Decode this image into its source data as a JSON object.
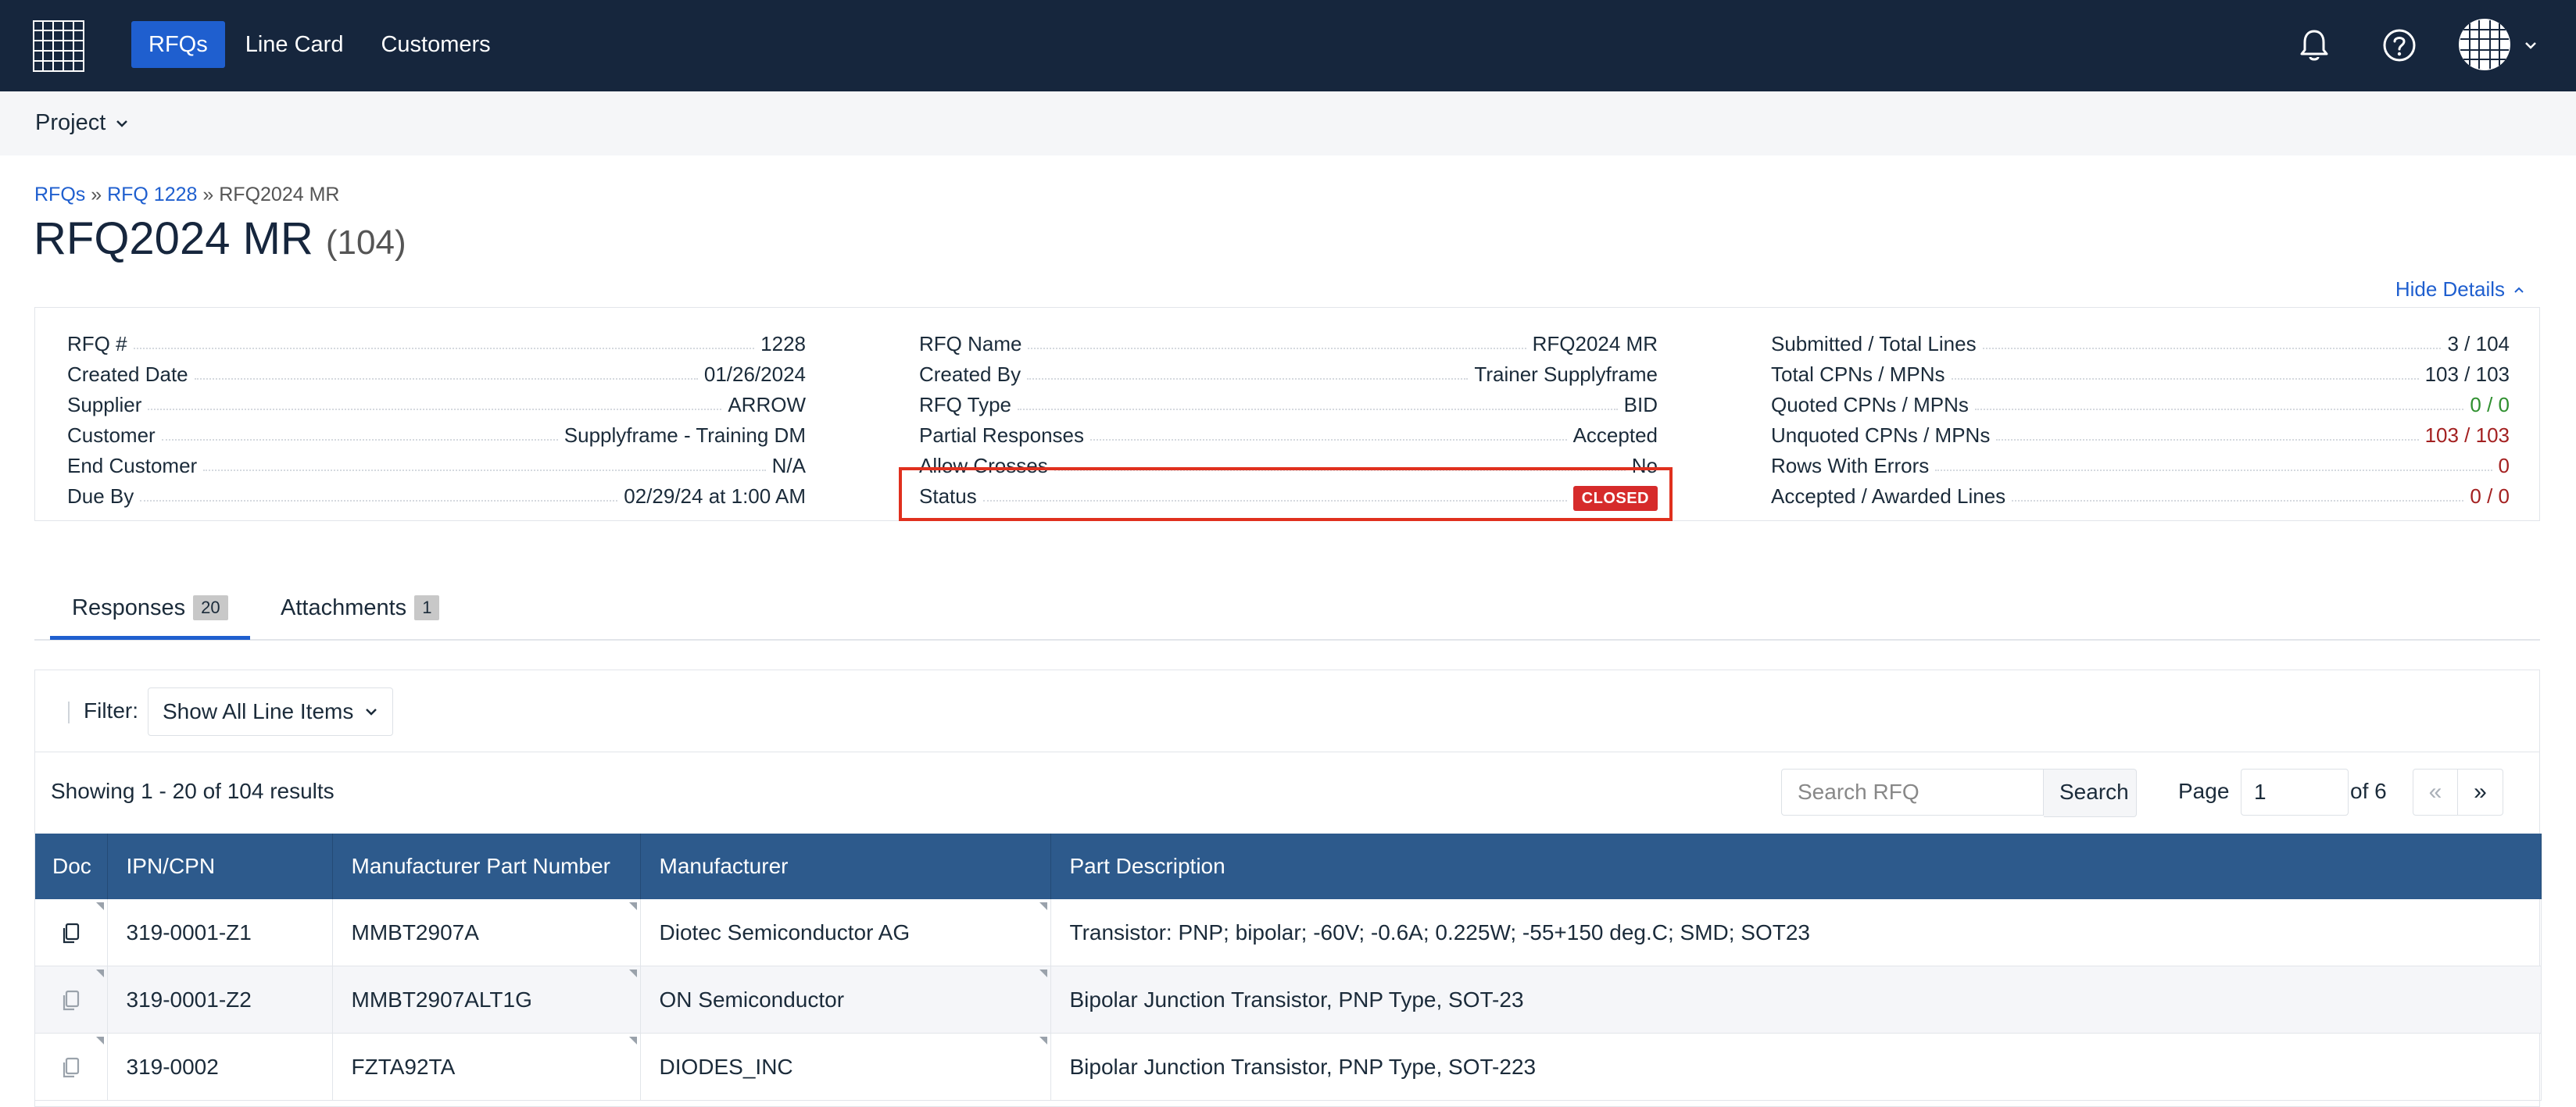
{
  "nav": {
    "items": [
      {
        "label": "RFQs",
        "active": true
      },
      {
        "label": "Line Card",
        "active": false
      },
      {
        "label": "Customers",
        "active": false
      }
    ],
    "icons": [
      "app-grid-icon",
      "bell-icon",
      "help-icon",
      "avatar-grid-icon",
      "chevron-down-icon"
    ]
  },
  "subnav": {
    "project_label": "Project"
  },
  "breadcrumb": {
    "items": [
      "RFQs",
      "RFQ 1228",
      "RFQ2024 MR"
    ],
    "separator": "»"
  },
  "title": {
    "name": "RFQ2024 MR",
    "count": "(104)"
  },
  "details_toggle": "Hide Details",
  "details": {
    "col1": [
      {
        "label": "RFQ #",
        "value": "1228"
      },
      {
        "label": "Created Date",
        "value": "01/26/2024"
      },
      {
        "label": "Supplier",
        "value": "ARROW"
      },
      {
        "label": "Customer",
        "value": "Supplyframe - Training DM"
      },
      {
        "label": "End Customer",
        "value": "N/A"
      },
      {
        "label": "Due By",
        "value": "02/29/24 at 1:00 AM"
      }
    ],
    "col2": [
      {
        "label": "RFQ Name",
        "value": "RFQ2024 MR"
      },
      {
        "label": "Created By",
        "value": "Trainer Supplyframe"
      },
      {
        "label": "RFQ Type",
        "value": "BID"
      },
      {
        "label": "Partial Responses",
        "value": "Accepted"
      },
      {
        "label": "Allow Crosses",
        "value": "No"
      },
      {
        "label": "Status",
        "value": "CLOSED"
      }
    ],
    "col3": [
      {
        "label": "Submitted / Total Lines",
        "value": "3 / 104"
      },
      {
        "label": "Total CPNs / MPNs",
        "value": "103 / 103"
      },
      {
        "label": "Quoted CPNs / MPNs",
        "value": "0 / 0"
      },
      {
        "label": "Unquoted CPNs / MPNs",
        "value": "103 / 103"
      },
      {
        "label": "Rows With Errors",
        "value": "0"
      },
      {
        "label": "Accepted / Awarded Lines",
        "value": "0 / 0"
      }
    ]
  },
  "colors": {
    "nav_bg": "#16263d",
    "accent": "#1f5fcf",
    "table_header": "#2d5a8c",
    "status_closed": "#d62b2b",
    "highlight_box": "#e0301e",
    "positive": "#2f8f2f",
    "negative": "#a32020"
  },
  "tabs": [
    {
      "label": "Responses",
      "badge": "20",
      "active": true
    },
    {
      "label": "Attachments",
      "badge": "1",
      "active": false
    }
  ],
  "filter": {
    "label": "Filter:",
    "selected": "Show All Line Items"
  },
  "results": {
    "showing": "Showing 1 - 20 of 104 results"
  },
  "search": {
    "placeholder": "Search RFQ",
    "button": "Search"
  },
  "pagination": {
    "label": "Page",
    "current": "1",
    "of": "of 6",
    "prev": "«",
    "next": "»"
  },
  "table": {
    "columns": [
      "Doc",
      "IPN/CPN",
      "Manufacturer Part Number",
      "Manufacturer",
      "Part Description"
    ],
    "rows": [
      {
        "ipn": "319-0001-Z1",
        "mpn": "MMBT2907A",
        "manufacturer": "Diotec Semiconductor AG",
        "description": "Transistor: PNP; bipolar; -60V; -0.6A; 0.225W; -55+150 deg.C; SMD; SOT23"
      },
      {
        "ipn": "319-0001-Z2",
        "mpn": "MMBT2907ALT1G",
        "manufacturer": "ON Semiconductor",
        "description": "Bipolar Junction Transistor, PNP Type, SOT-23"
      },
      {
        "ipn": "319-0002",
        "mpn": "FZTA92TA",
        "manufacturer": "DIODES_INC",
        "description": "Bipolar Junction Transistor, PNP Type, SOT-223"
      }
    ]
  }
}
